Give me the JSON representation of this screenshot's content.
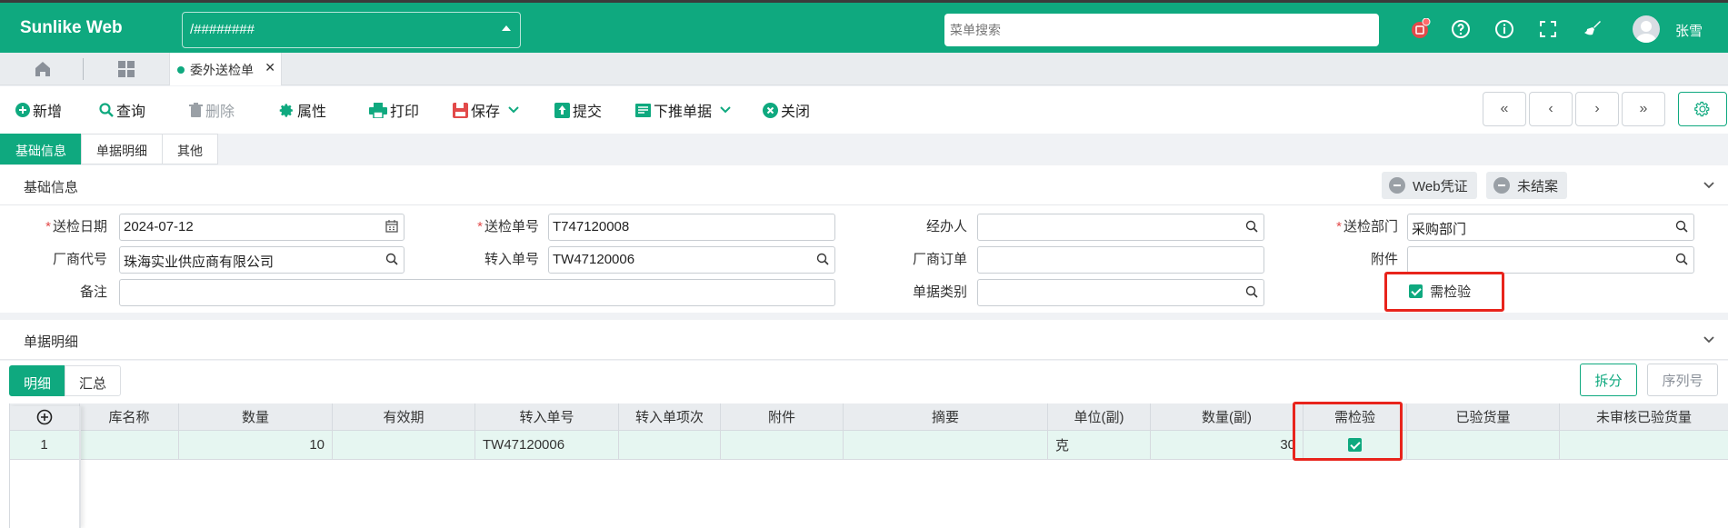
{
  "app": {
    "brand": "Sunlike Web",
    "path_value": "/########",
    "search_placeholder": "菜单搜索",
    "username": "张雪"
  },
  "header_icons": [
    "notification-icon",
    "help-icon",
    "info-icon",
    "fullscreen-icon",
    "broom-icon"
  ],
  "tabs": {
    "home": "home-icon",
    "apps": "grid-icon",
    "open_page": "委外送检单"
  },
  "toolbar": {
    "new": "新增",
    "query": "查询",
    "delete": "删除",
    "properties": "属性",
    "print": "打印",
    "save": "保存",
    "submit": "提交",
    "push": "下推单据",
    "close": "关闭"
  },
  "section_tabs": [
    "基础信息",
    "单据明细",
    "其他"
  ],
  "basic": {
    "title": "基础信息",
    "status1": "Web凭证",
    "status2": "未结案",
    "labels": {
      "date": "送检日期",
      "order_no": "送检单号",
      "handler": "经办人",
      "dept": "送检部门",
      "vendor": "厂商代号",
      "transfer_no": "转入单号",
      "vendor_order": "厂商订单",
      "attachment": "附件",
      "remark": "备注",
      "doc_type": "单据类别",
      "need_inspect": "需检验"
    },
    "values": {
      "date": "2024-07-12",
      "order_no": "T747120008",
      "handler": "",
      "dept": "采购部门",
      "vendor": "珠海实业供应商有限公司",
      "transfer_no": "TW47120006",
      "vendor_order": "",
      "attachment": "",
      "remark": "",
      "doc_type": ""
    }
  },
  "detail": {
    "title": "单据明细",
    "subtabs": [
      "明细",
      "汇总"
    ],
    "split": "拆分",
    "serial": "序列号",
    "columns": [
      "库名称",
      "数量",
      "有效期",
      "转入单号",
      "转入单项次",
      "附件",
      "摘要",
      "单位(副)",
      "数量(副)",
      "需检验",
      "已验货量",
      "未审核已验货量"
    ],
    "rows": [
      {
        "index": "1",
        "warehouse": "",
        "qty": "10",
        "expiry": "",
        "transfer_no": "TW47120006",
        "transfer_item": "",
        "attachment": "",
        "summary": "",
        "unit2": "克",
        "qty2": "30",
        "need_inspect": true,
        "inspected": "",
        "unapproved": ""
      }
    ]
  },
  "colors": {
    "primary": "#0fa97f",
    "highlight": "#e8241c"
  }
}
